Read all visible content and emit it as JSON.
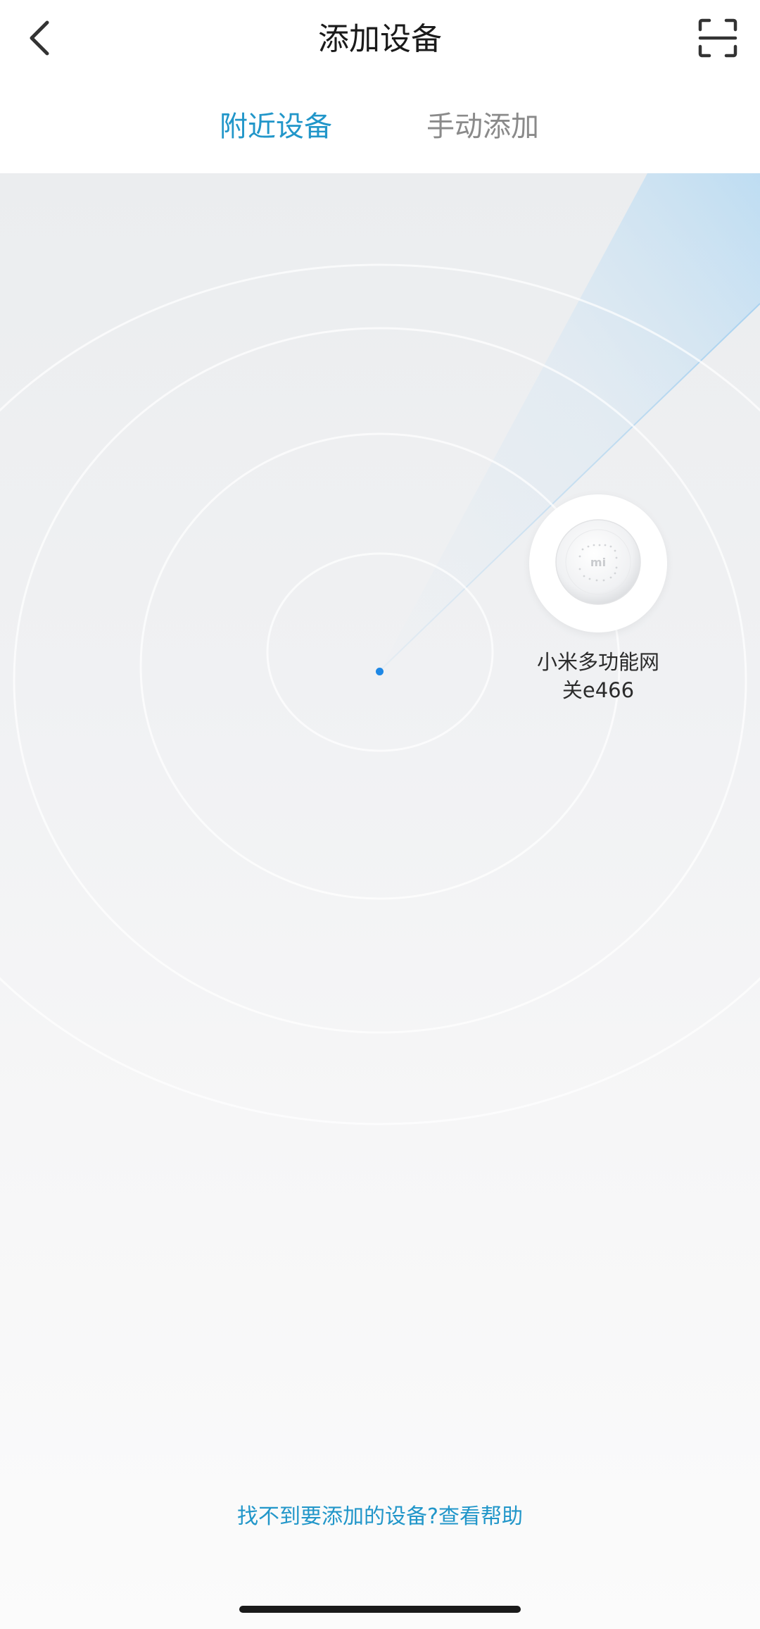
{
  "header": {
    "title": "添加设备",
    "back_icon": "chevron-left-icon",
    "scan_icon": "scan-frame-icon"
  },
  "tabs": [
    {
      "label": "附近设备",
      "active": true
    },
    {
      "label": "手动添加",
      "active": false
    }
  ],
  "radar": {
    "devices": [
      {
        "name": "小米多功能网关e466",
        "icon": "mi-gateway-icon",
        "logo_text": "mi"
      }
    ]
  },
  "footer": {
    "help_question": "找不到要添加的设备?",
    "help_action": "查看帮助"
  },
  "colors": {
    "accent": "#2196c9",
    "inactive_tab": "#8a8a8a",
    "dot": "#1e88e5"
  }
}
